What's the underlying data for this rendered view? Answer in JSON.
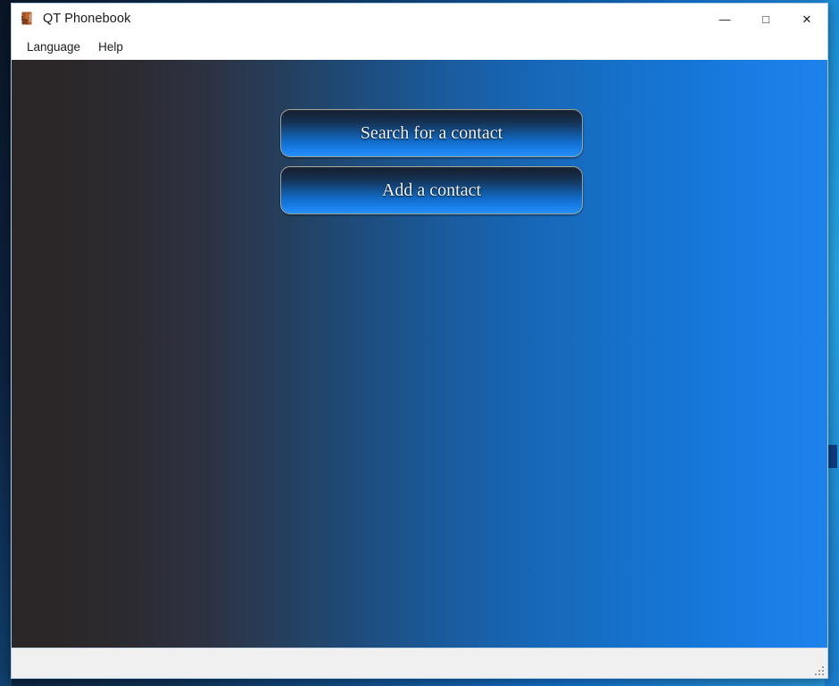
{
  "window": {
    "title": "QT Phonebook",
    "icon": "phonebook-app-icon",
    "controls": {
      "minimize_label": "—",
      "minimize_name": "minimize",
      "maximize_label": "□",
      "maximize_name": "maximize",
      "close_label": "✕",
      "close_name": "close"
    }
  },
  "menu": {
    "items": [
      {
        "label": "Language"
      },
      {
        "label": "Help"
      }
    ]
  },
  "main": {
    "buttons": [
      {
        "label": "Search for a contact",
        "name": "search-for-a-contact"
      },
      {
        "label": "Add a contact",
        "name": "add-a-contact"
      }
    ]
  },
  "status_bar": {
    "text": "",
    "grip": "resize-grip"
  },
  "colors": {
    "content_gradient_start": "#2b2729",
    "content_gradient_end": "#1f82ec",
    "button_top": "#16202f",
    "button_bottom": "#2a90f5",
    "button_border": "#9aa59a",
    "button_text": "#f2f6fb",
    "title_bar_bg": "#ffffff",
    "status_bar_bg": "#f0f0f0",
    "desktop_accent": "#1576d4"
  }
}
